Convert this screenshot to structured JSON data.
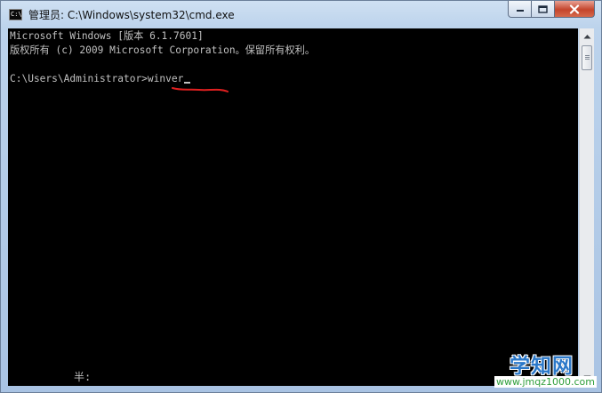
{
  "window": {
    "title": "管理员: C:\\Windows\\system32\\cmd.exe",
    "icon_label": "C:\\",
    "icon": "cmd-icon",
    "buttons": {
      "minimize": "minimize-icon",
      "maximize": "maximize-icon",
      "close": "close-icon"
    }
  },
  "console": {
    "lines": [
      "Microsoft Windows [版本 6.1.7601]",
      "版权所有 (c) 2009 Microsoft Corporation。保留所有权利。",
      "",
      "C:\\Users\\Administrator>winver"
    ],
    "ime_indicator": "半:",
    "text_color": "#c0c0c0",
    "background": "#000000",
    "annotation_color": "#e02020"
  },
  "scrollbar": {
    "up_icon": "scroll-up-arrow-icon",
    "down_icon": "scroll-down-arrow-icon"
  },
  "watermark": {
    "title": "学知网",
    "url": "www.jmqz1000.com",
    "title_color": "#2b78c9",
    "url_color": "#2e9e3a"
  }
}
